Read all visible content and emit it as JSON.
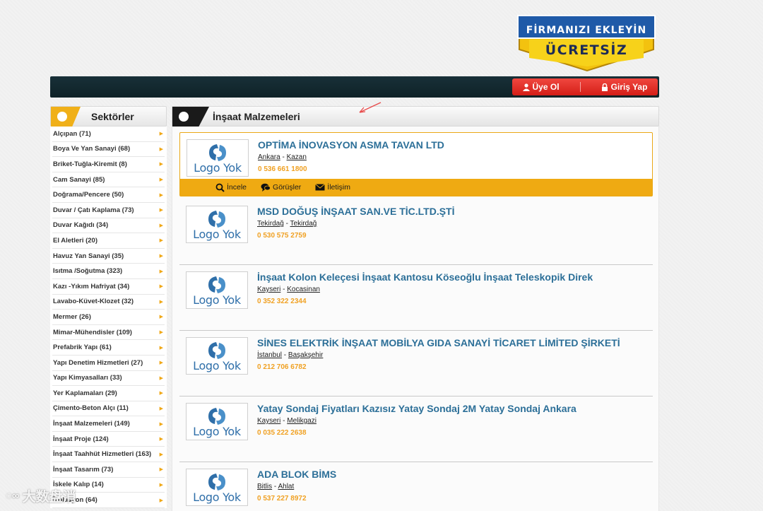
{
  "promo": {
    "line1": "FİRMANIZI EKLEYİN",
    "line2": "ÜCRETSİZ"
  },
  "auth": {
    "register": "Üye Ol",
    "login": "Giriş Yap"
  },
  "sidebar": {
    "title": "Sektörler",
    "items": [
      "Alçıpan (71)",
      "Boya Ve Yan Sanayi (68)",
      "Briket-Tuğla-Kiremit (8)",
      "Cam Sanayi (85)",
      "Doğrama/Pencere (50)",
      "Duvar / Çatı Kaplama (73)",
      "Duvar Kağıdı (34)",
      "El Aletleri (20)",
      "Havuz Yan Sanayi (35)",
      "Isıtma /Soğutma (323)",
      "Kazı -Yıkım Hafriyat (34)",
      "Lavabo-Küvet-Klozet (32)",
      "Mermer (26)",
      "Mimar-Mühendisler (109)",
      "Prefabrik Yapı (61)",
      "Yapı Denetim Hizmetleri (27)",
      "Yapı Kimyasalları (33)",
      "Yer Kaplamaları (29)",
      "Çimento-Beton Alçı (11)",
      "İnşaat Malzemeleri (149)",
      "İnşaat Proje (124)",
      "İnşaat Taahhüt Hizmetleri (163)",
      "İnşaat Tasarım (73)",
      "İskele Kalıp (14)",
      "İzolasyon (64)"
    ]
  },
  "main": {
    "title": "İnşaat Malzemeleri",
    "logo_text": "Logo Yok",
    "actions": {
      "view": "İncele",
      "reviews": "Görüşler",
      "contact": "İletişim"
    },
    "companies": [
      {
        "name": "OPTİMA İNOVASYON ASMA TAVAN LTD",
        "city": "Ankara",
        "district": "Kazan",
        "phone": "0 536 661 1800"
      },
      {
        "name": "MSD DOĞUŞ İNŞAAT SAN.VE TİC.LTD.ŞTİ",
        "city": "Tekirdağ",
        "district": "Tekirdağ",
        "phone": "0 530 575 2759"
      },
      {
        "name": "İnşaat Kolon Keleçesi İnşaat Kantosu Köseoğlu İnşaat Teleskopik Direk",
        "city": "Kayseri",
        "district": "Kocasinan",
        "phone": "0 352 322 2344"
      },
      {
        "name": "SİNES ELEKTRİK İNŞAAT MOBİLYA GIDA SANAYİ TİCARET LİMİTED ŞİRKETİ",
        "city": "İstanbul",
        "district": "Başakşehir",
        "phone": "0 212 706 6782"
      },
      {
        "name": "Yatay Sondaj Fiyatları Kazısız Yatay Sondaj 2M Yatay Sondaj Ankara",
        "city": "Kayseri",
        "district": "Melikgazi",
        "phone": "0 035 222 2638"
      },
      {
        "name": "ADA BLOK BİMS",
        "city": "Bitlis",
        "district": "Ahlat",
        "phone": "0 537 227 8972"
      }
    ]
  },
  "watermark": "大数盘消"
}
